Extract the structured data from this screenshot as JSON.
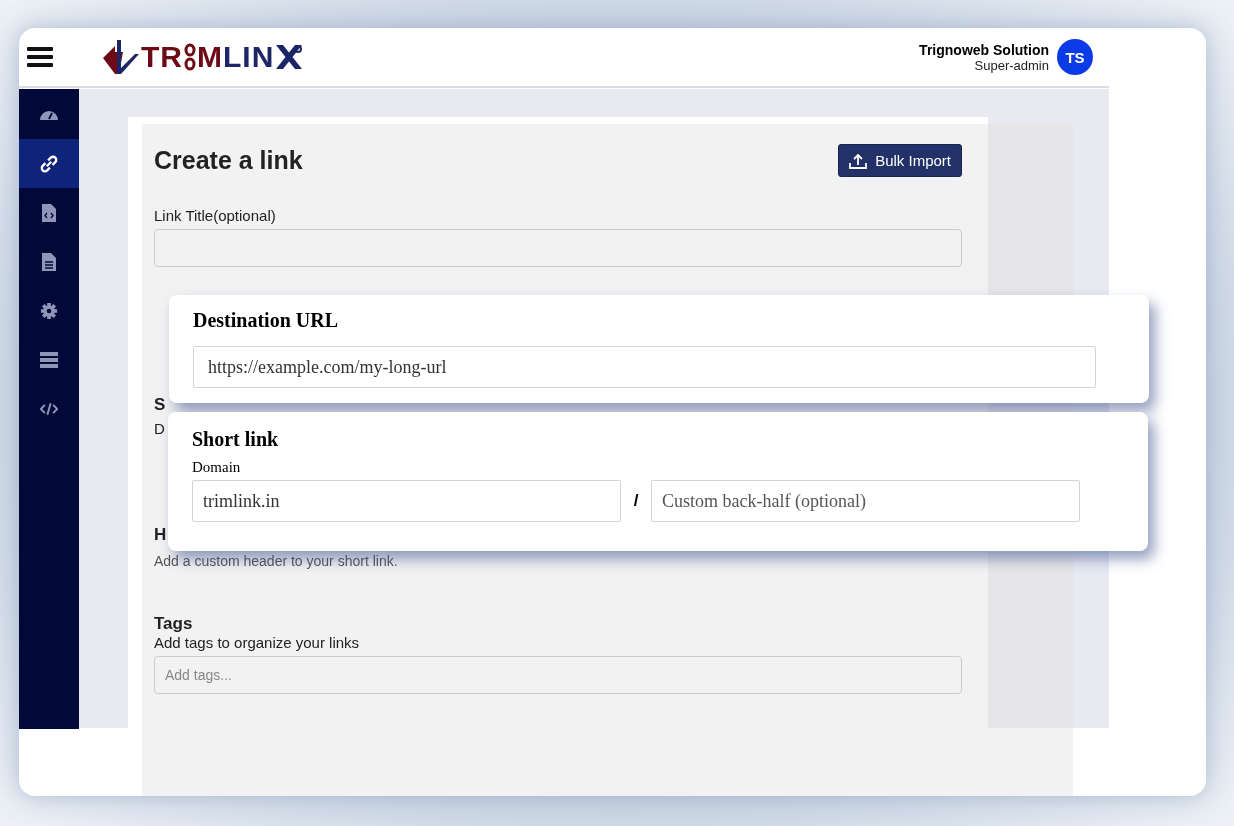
{
  "header": {
    "logo": [
      {
        "text": "TR",
        "color": "#6e0a16"
      },
      {
        "kind": "chain"
      },
      {
        "text": "M",
        "color": "#6e0a16"
      },
      {
        "text": "LIN",
        "color": "#1c2566"
      },
      {
        "kind": "x"
      }
    ],
    "user": {
      "name": "Trignoweb Solution",
      "role": "Super-admin",
      "initials": "TS"
    }
  },
  "sidebar": {
    "items": [
      {
        "selected": false
      },
      {
        "selected": true
      },
      {
        "selected": false
      },
      {
        "selected": false
      },
      {
        "selected": false
      },
      {
        "selected": false
      },
      {
        "selected": false
      }
    ]
  },
  "form": {
    "title": "Create a link",
    "bulk_import": "Bulk Import",
    "link_title": {
      "label": "Link Title(optional)"
    },
    "covered_fragments": {
      "section": "S",
      "field": "D",
      "header_heading": "H",
      "header_hint": "Add a custom header to your short link."
    },
    "tags": {
      "heading": "Tags",
      "hint": "Add tags to organize your links",
      "placeholder": "Add tags..."
    }
  },
  "destination_card": {
    "title": "Destination URL",
    "value": "https://example.com/my-long-url"
  },
  "short_link_card": {
    "title": "Short link",
    "domain_label": "Domain",
    "domain": "trimlink.in",
    "separator": "/",
    "back_half_placeholder": "Custom back-half (optional)"
  }
}
